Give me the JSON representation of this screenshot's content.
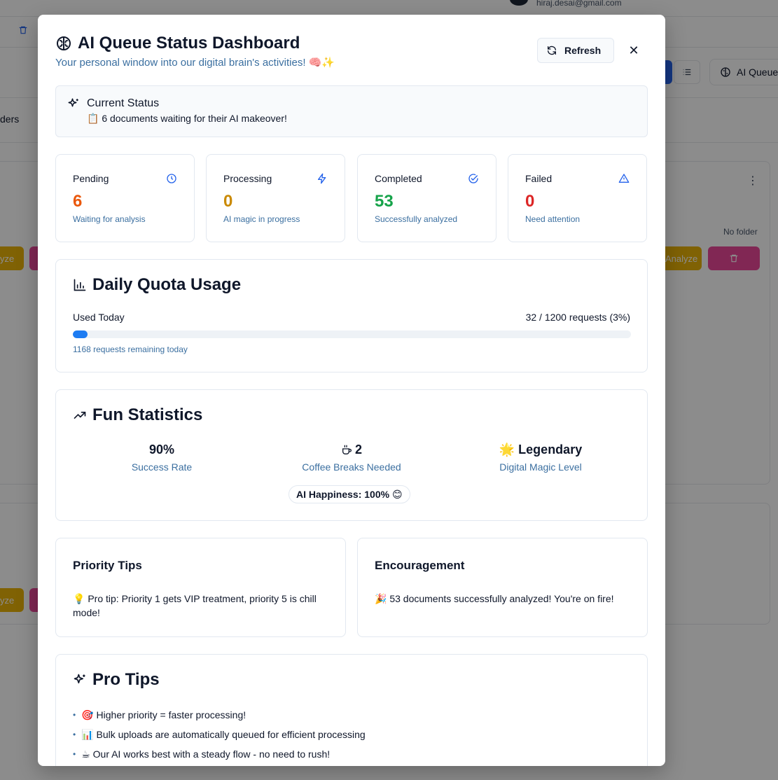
{
  "background": {
    "email": "hiraj.desai@gmail.com",
    "folders_partial": "ders",
    "ai_queue_button": "AI Queue",
    "no_folder": "No folder",
    "analyze_partial_left": "yze",
    "analyze_partial_right": "Analyze"
  },
  "modal": {
    "title": "AI Queue Status Dashboard",
    "subtitle": "Your personal window into our digital brain's activities! 🧠✨",
    "refresh_label": "Refresh",
    "close_icon": "✕"
  },
  "current_status": {
    "title": "Current Status",
    "text": "📋 6 documents waiting for their AI makeover!"
  },
  "stats": [
    {
      "label": "Pending",
      "value": "6",
      "sub": "Waiting for analysis",
      "color": "#ea580c",
      "icon": "clock-icon"
    },
    {
      "label": "Processing",
      "value": "0",
      "sub": "AI magic in progress",
      "color": "#ca8a04",
      "icon": "zap-icon"
    },
    {
      "label": "Completed",
      "value": "53",
      "sub": "Successfully analyzed",
      "color": "#16a34a",
      "icon": "check-circle-icon"
    },
    {
      "label": "Failed",
      "value": "0",
      "sub": "Need attention",
      "color": "#dc2626",
      "icon": "alert-triangle-icon"
    }
  ],
  "quota": {
    "title": "Daily Quota Usage",
    "used_label": "Used Today",
    "count_text": "32 / 1200 requests (3%)",
    "used": 32,
    "total": 1200,
    "remaining_text": "1168 requests remaining today",
    "accent": "#1d7cf2"
  },
  "fun": {
    "title": "Fun Statistics",
    "items": [
      {
        "value": "90%",
        "label": "Success Rate"
      },
      {
        "value": "2",
        "label": "Coffee Breaks Needed",
        "icon": "coffee-icon"
      },
      {
        "value": "🌟 Legendary",
        "label": "Digital Magic Level"
      }
    ],
    "happiness": "AI Happiness: 100% 😊"
  },
  "priority_tips": {
    "title": "Priority Tips",
    "text": "💡 Pro tip: Priority 1 gets VIP treatment, priority 5 is chill mode!"
  },
  "encouragement": {
    "title": "Encouragement",
    "text": "🎉 53 documents successfully analyzed! You're on fire!"
  },
  "pro_tips": {
    "title": "Pro Tips",
    "items": [
      "🎯 Higher priority = faster processing!",
      "📊 Bulk uploads are automatically queued for efficient processing",
      "☕ Our AI works best with a steady flow - no need to rush!"
    ]
  }
}
